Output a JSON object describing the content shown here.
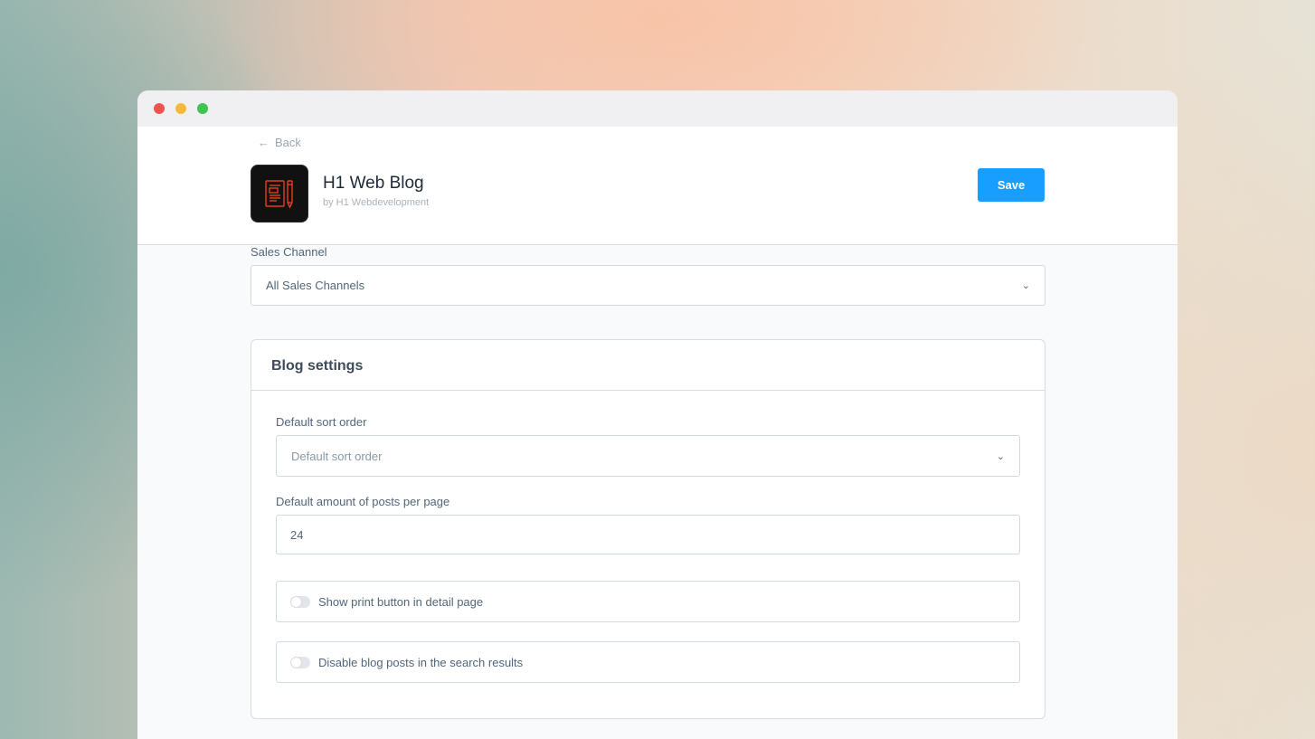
{
  "window": {
    "controls": [
      "close",
      "minimize",
      "maximize"
    ]
  },
  "header": {
    "back_label": "Back",
    "back_icon": "arrow-left-icon",
    "app_title": "H1 Web Blog",
    "app_vendor": "by H1 Webdevelopment",
    "app_icon": "blog-document-icon",
    "save_label": "Save"
  },
  "sales_channel": {
    "label": "Sales Channel",
    "value": "All Sales Channels",
    "icon": "chevron-down-icon"
  },
  "blog_settings": {
    "title": "Blog settings",
    "sort_order": {
      "label": "Default sort order",
      "placeholder": "Default sort order"
    },
    "posts_per_page": {
      "label": "Default amount of posts per page",
      "value": "24"
    },
    "toggles": [
      {
        "label": "Show print button in detail page",
        "enabled": false
      },
      {
        "label": "Disable blog posts in the search results",
        "enabled": false
      }
    ]
  },
  "colors": {
    "accent": "#189eff",
    "close": "#ef5350",
    "minimize": "#f5b83a",
    "maximize": "#3fc450",
    "icon_stroke": "#e0401f"
  }
}
